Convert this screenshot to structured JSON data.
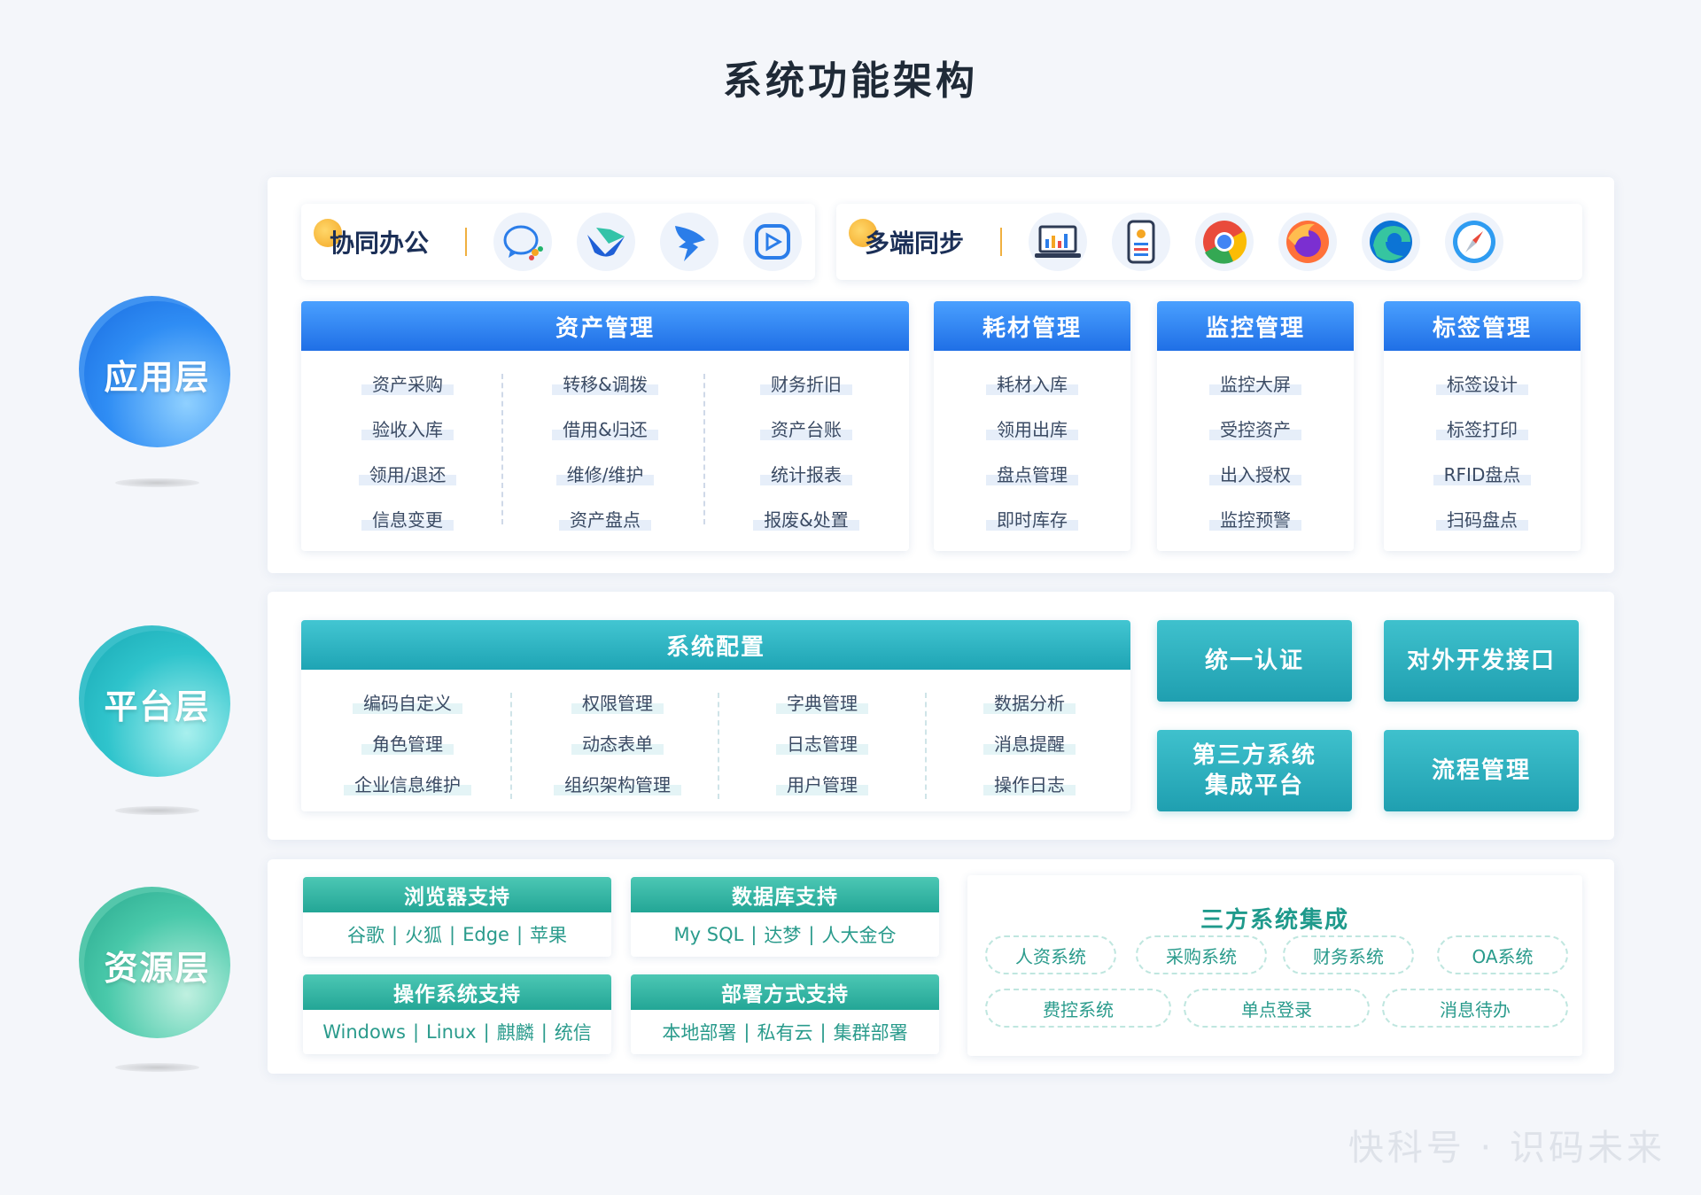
{
  "title": "系统功能架构",
  "layers": {
    "app": "应用层",
    "platform": "平台层",
    "resource": "资源层"
  },
  "collab": {
    "title": "协同办公",
    "icons": [
      "wecom-icon",
      "lark-icon",
      "dingtalk-icon",
      "tencent-meeting-icon"
    ]
  },
  "multi": {
    "title": "多端同步",
    "icons": [
      "laptop-icon",
      "mobile-icon",
      "chrome-icon",
      "firefox-icon",
      "edge-icon",
      "safari-icon"
    ]
  },
  "modules": {
    "asset": {
      "title": "资产管理",
      "col1": [
        "资产采购",
        "验收入库",
        "领用/退还",
        "信息变更"
      ],
      "col2": [
        "转移&调拨",
        "借用&归还",
        "维修/维护",
        "资产盘点"
      ],
      "col3": [
        "财务折旧",
        "资产台账",
        "统计报表",
        "报废&处置"
      ]
    },
    "consumable": {
      "title": "耗材管理",
      "items": [
        "耗材入库",
        "领用出库",
        "盘点管理",
        "即时库存"
      ]
    },
    "monitor": {
      "title": "监控管理",
      "items": [
        "监控大屏",
        "受控资产",
        "出入授权",
        "监控预警"
      ]
    },
    "label": {
      "title": "标签管理",
      "items": [
        "标签设计",
        "标签打印",
        "RFID盘点",
        "扫码盘点"
      ]
    }
  },
  "platform": {
    "config_title": "系统配置",
    "col1": [
      "编码自定义",
      "角色管理",
      "企业信息维护"
    ],
    "col2": [
      "权限管理",
      "动态表单",
      "组织架构管理"
    ],
    "col3": [
      "字典管理",
      "日志管理",
      "用户管理"
    ],
    "col4": [
      "数据分析",
      "消息提醒",
      "操作日志"
    ],
    "auth": "统一认证",
    "api": "对外开发接口",
    "third_line1": "第三方系统",
    "third_line2": "集成平台",
    "flow": "流程管理"
  },
  "resource": {
    "browser": {
      "title": "浏览器支持",
      "items": [
        "谷歌",
        "火狐",
        "Edge",
        "苹果"
      ]
    },
    "database": {
      "title": "数据库支持",
      "items": [
        "My SQL",
        "达梦",
        "人大金仓"
      ]
    },
    "os": {
      "title": "操作系统支持",
      "items": [
        "Windows",
        "Linux",
        "麒麟",
        "统信"
      ]
    },
    "deploy": {
      "title": "部署方式支持",
      "items": [
        "本地部署",
        "私有云",
        "集群部署"
      ]
    },
    "third": {
      "title": "三方系统集成",
      "row1": [
        "人资系统",
        "采购系统",
        "财务系统",
        "OA系统"
      ],
      "row2": [
        "费控系统",
        "单点登录",
        "消息待办"
      ]
    }
  },
  "watermark": "快科号 · 识码未来"
}
